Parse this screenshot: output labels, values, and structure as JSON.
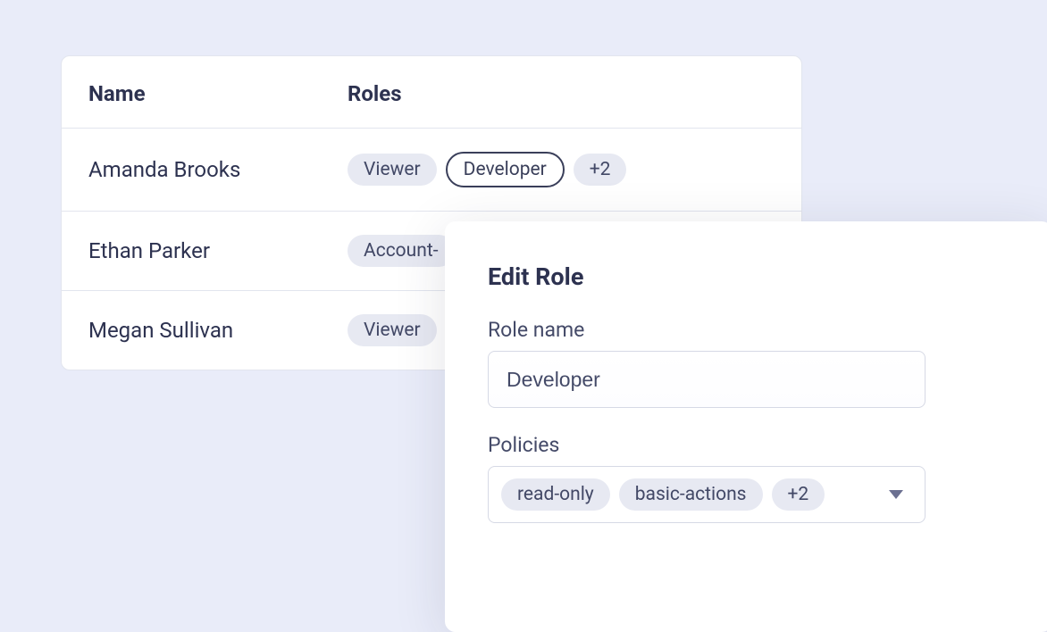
{
  "table": {
    "headers": {
      "name": "Name",
      "roles": "Roles"
    },
    "rows": [
      {
        "name": "Amanda Brooks",
        "roles": [
          {
            "label": "Viewer",
            "variant": "default"
          },
          {
            "label": "Developer",
            "variant": "outlined"
          },
          {
            "label": "+2",
            "variant": "default"
          }
        ]
      },
      {
        "name": "Ethan Parker",
        "roles": [
          {
            "label": "Account-",
            "variant": "default"
          }
        ]
      },
      {
        "name": "Megan Sullivan",
        "roles": [
          {
            "label": "Viewer",
            "variant": "default"
          }
        ]
      }
    ]
  },
  "editPanel": {
    "title": "Edit Role",
    "roleNameLabel": "Role name",
    "roleNameValue": "Developer",
    "policiesLabel": "Policies",
    "policies": [
      {
        "label": "read-only"
      },
      {
        "label": "basic-actions"
      },
      {
        "label": "+2"
      }
    ]
  }
}
